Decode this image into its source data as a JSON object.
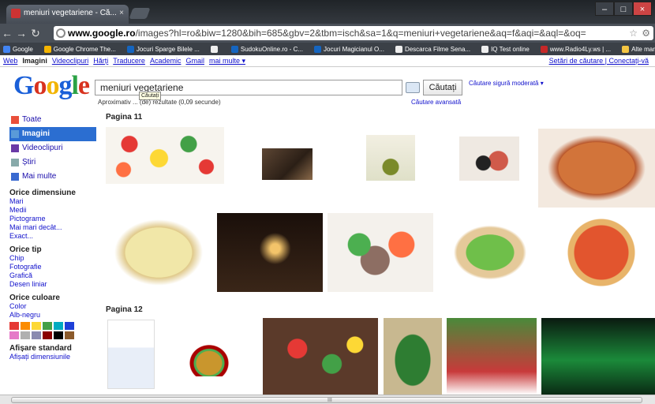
{
  "browser": {
    "tab_title": "meniuri vegetariene - Că...",
    "url_domain": "www.google.ro",
    "url_rest": "/images?hl=ro&biw=1280&bih=685&gbv=2&tbm=isch&sa=1&q=meniuri+vegetariene&aq=f&aqi=&aql=&oq=",
    "bookmarks": [
      {
        "label": "Google",
        "color": "#4285f4"
      },
      {
        "label": "Google Chrome The...",
        "color": "#f4b400"
      },
      {
        "label": "Jocuri Sparge Bilele ...",
        "color": "#1565c0"
      },
      {
        "label": "",
        "color": "#eee"
      },
      {
        "label": "SudokuOnline.ro - C...",
        "color": "#1565c0"
      },
      {
        "label": "Jocuri Magicianul O...",
        "color": "#1565c0"
      },
      {
        "label": "Descarca Filme Sena...",
        "color": "#eee"
      },
      {
        "label": "IQ Test online",
        "color": "#eee"
      },
      {
        "label": "www.Radio4Ly.ws | ...",
        "color": "#c62828"
      },
      {
        "label": "Alte marcaje",
        "color": "#f4c542"
      }
    ]
  },
  "gbar": {
    "links": [
      "Web",
      "Imagini",
      "Videoclipuri",
      "Hărți",
      "Traducere",
      "Academic",
      "Gmail",
      "mai multe ▾"
    ],
    "active": "Imagini",
    "right": "Setări de căutare | Conectați-vă"
  },
  "search": {
    "logo": "Google",
    "query": "meniuri vegetariene",
    "button": "Căutați",
    "tooltip": "Căutați",
    "safesearch": "Căutare sigură moderată ▾",
    "stats": "Aproximativ ... (de) rezultate (0,09 secunde)",
    "advanced": "Căutare avansată"
  },
  "sidebar": {
    "types": [
      {
        "label": "Toate",
        "icon": "all-icon",
        "color": "#e94f3b",
        "active": false
      },
      {
        "label": "Imagini",
        "icon": "images-icon",
        "color": "#5a9bd8",
        "active": true
      },
      {
        "label": "Videoclipuri",
        "icon": "video-icon",
        "color": "#6a3aa6",
        "active": false
      },
      {
        "label": "Știri",
        "icon": "news-icon",
        "color": "#8aa",
        "active": false
      },
      {
        "label": "Mai multe",
        "icon": "more-icon",
        "color": "#3a6ad0",
        "active": false
      }
    ],
    "size_heading": "Orice dimensiune",
    "sizes": [
      "Mari",
      "Medii",
      "Pictograme",
      "Mai mari decât...",
      "Exact..."
    ],
    "type_heading": "Orice tip",
    "types_filter": [
      "Chip",
      "Fotografie",
      "Grafică",
      "Desen liniar"
    ],
    "color_heading": "Orice culoare",
    "colors_filter": [
      "Color",
      "Alb-negru"
    ],
    "swatches": [
      "#e53935",
      "#fb8c00",
      "#fdd835",
      "#43a047",
      "#00acc1",
      "#1e40d8",
      "#e57ac8",
      "#b0b0b0",
      "#8a8ab0",
      "#8b0000",
      "#000000",
      "#8b5a2b"
    ],
    "display_heading": "Afișare standard",
    "display_link": "Afișați dimensiunile"
  },
  "results": {
    "page11": "Pagina 11",
    "page12": "Pagina 12"
  }
}
